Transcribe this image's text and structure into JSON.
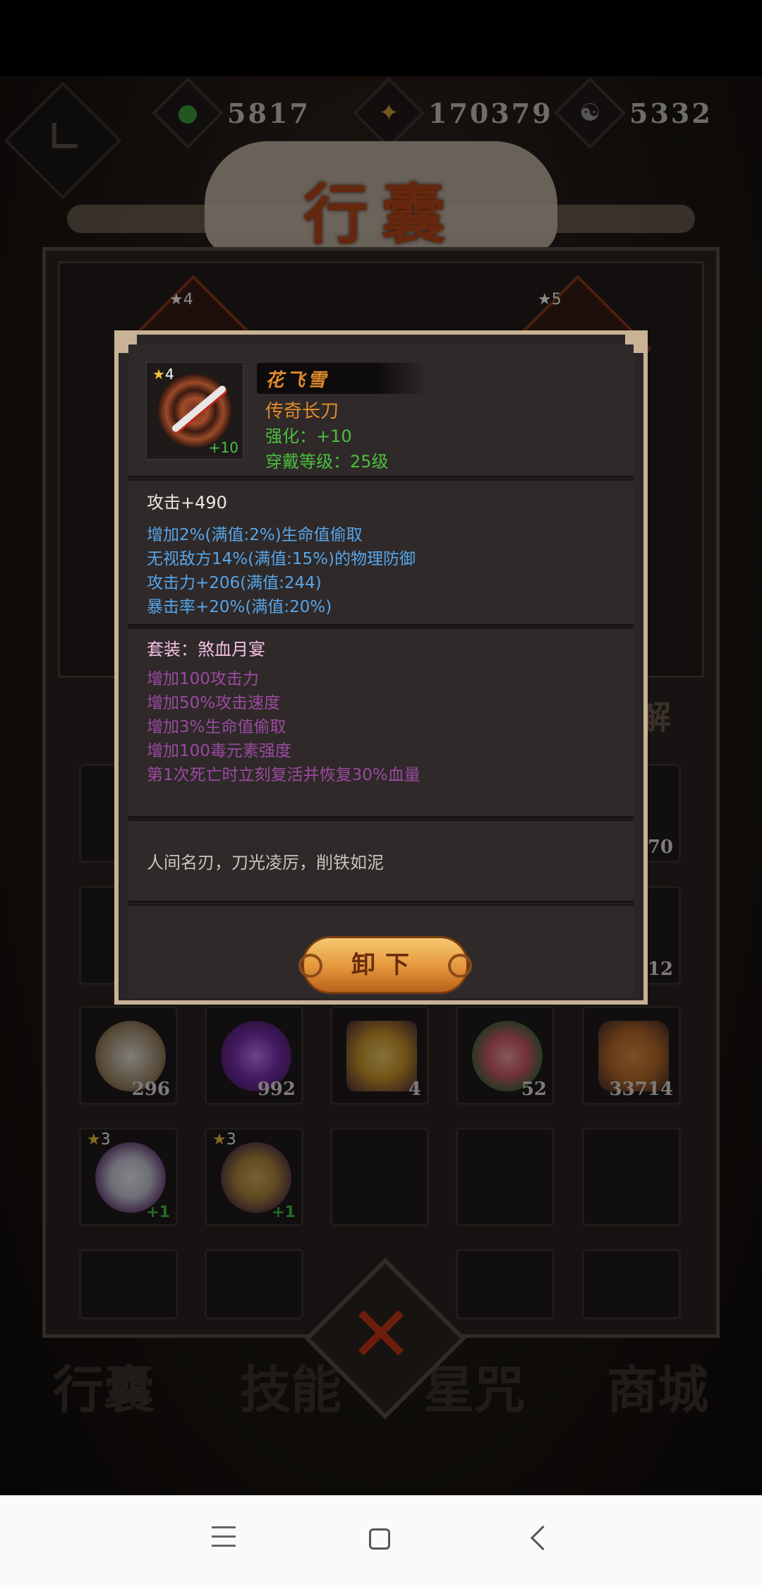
{
  "currencies": [
    {
      "icon": "jade-drop-icon",
      "value": "5817",
      "color": "#3fa13a"
    },
    {
      "icon": "gold-coin-icon",
      "value": "170379",
      "color": "#d6a13a"
    },
    {
      "icon": "yinyang-icon",
      "value": "5332",
      "color": "#9a9a9a"
    }
  ],
  "page_title": "行囊",
  "equip_slots": [
    {
      "stars": "4"
    },
    {
      "stars": "5"
    }
  ],
  "inventory_items": [
    {
      "icon": "rice-sack-icon",
      "count": "296",
      "color": "#cfc3b0"
    },
    {
      "icon": "purple-orb-icon",
      "count": "992",
      "color": "#7b2fb0"
    },
    {
      "icon": "scroll-icon",
      "count": "4",
      "color": "#d09a2a"
    },
    {
      "icon": "peach-icon",
      "count": "52",
      "color": "#e27a7a"
    },
    {
      "icon": "wooden-bucket-icon",
      "count": "33714",
      "color": "#b86a2a"
    },
    {
      "icon": "demon-mask-icon",
      "stars": "3",
      "level": "+1",
      "color": "#c8c8d8"
    },
    {
      "icon": "gold-crown-icon",
      "stars": "3",
      "level": "+1",
      "color": "#b08a3a"
    }
  ],
  "partial_counts": {
    "row1_right": "70",
    "row2_right": "12"
  },
  "nav": {
    "bag": "行囊",
    "skills": "技能",
    "stars": "星咒",
    "shop": "商城"
  },
  "tooltip": {
    "stars": "4",
    "enhance_badge": "+10",
    "name": "花飞雪",
    "type": "传奇长刀",
    "enhance": "强化：+10",
    "wear_level": "穿戴等级：25级",
    "main_stat": "攻击+490",
    "sub_stats": [
      "增加2%(满值:2%)生命值偷取",
      "无视敌方14%(满值:15%)的物理防御",
      "攻击力+206(满值:244)",
      "暴击率+20%(满值:20%)"
    ],
    "set_title": "套装：煞血月宴",
    "set_bonuses": [
      "增加100攻击力",
      "增加50%攻击速度",
      "增加3%生命值偷取",
      "增加100毒元素强度",
      "第1次死亡时立刻复活并恢复30%血量"
    ],
    "flavor": "人间名刃，刀光凌厉，削铁如泥",
    "unequip_label": "卸下"
  },
  "side_label": "解"
}
